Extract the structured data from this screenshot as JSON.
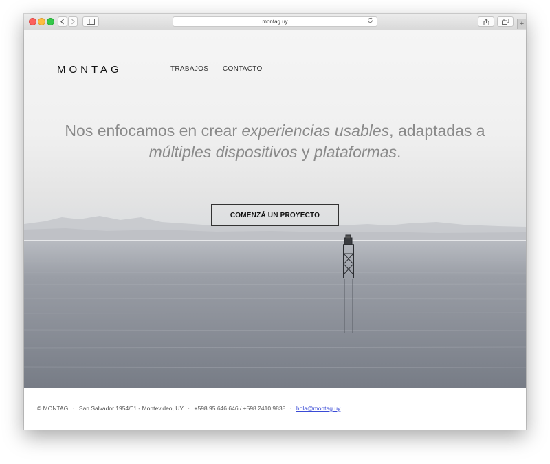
{
  "browser": {
    "url": "montag.uy",
    "back_icon": "chevron-left-icon",
    "forward_icon": "chevron-right-icon",
    "sidebar_icon": "sidebar-icon",
    "reload_icon": "reload-icon",
    "share_icon": "share-icon",
    "tabs_icon": "tabs-icon",
    "new_tab_label": "+"
  },
  "header": {
    "logo": "MONTAG",
    "nav": [
      "TRABAJOS",
      "CONTACTO"
    ]
  },
  "hero": {
    "headline_1": "Nos enfocamos en crear ",
    "headline_em_1": "experiencias usables",
    "headline_2": ", adaptadas a",
    "headline_em_2": "múltiples dispositivos",
    "headline_3": " y ",
    "headline_em_3": "plataformas",
    "headline_4": ".",
    "cta_label": "COMENZÁ UN PROYECTO"
  },
  "footer": {
    "copyright": "© MONTAG",
    "address": "San Salvador 1954/01 - Montevideo, UY",
    "phones": "+598 95 646 646 / +598 2410 9838",
    "email": "hola@montag.uy",
    "separator": "·"
  },
  "colors": {
    "link": "#3a4bd6",
    "headline": "#8a8a8a"
  }
}
